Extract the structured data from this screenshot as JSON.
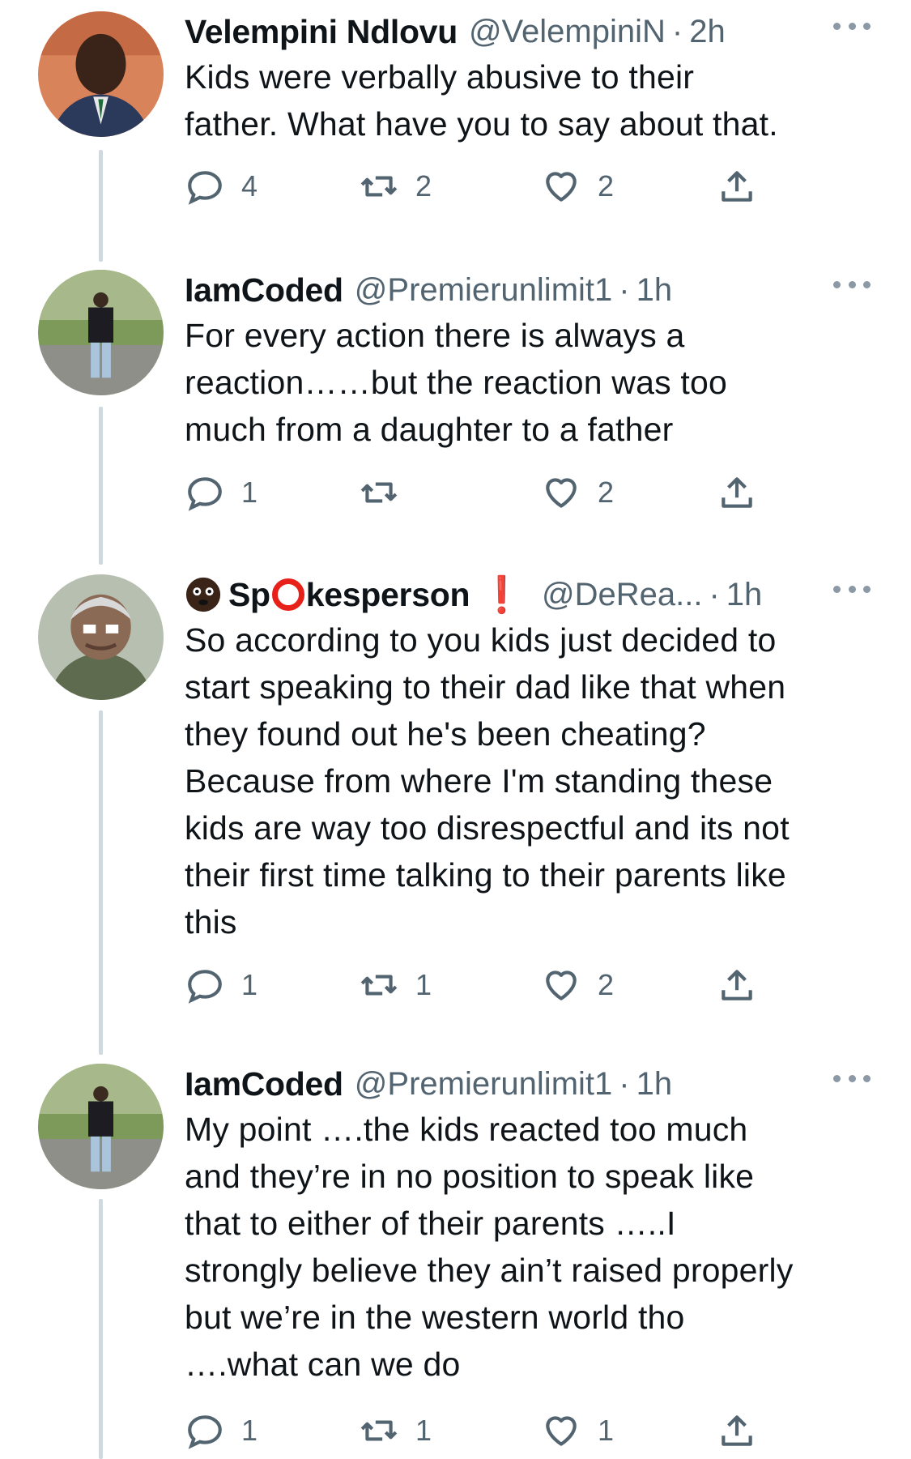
{
  "tweets": [
    {
      "display_name": "Velempini Ndlovu",
      "handle": "@VelempiniN",
      "separator": "·",
      "time": "2h",
      "text": "Kids were verbally abusive to their\nfather. What have you to say about that.",
      "replies": "4",
      "retweets": "2",
      "likes": "2"
    },
    {
      "display_name": "IamCoded",
      "handle": "@Premierunlimit1",
      "separator": "·",
      "time": "1h",
      "text": "For every action there is always a\nreaction……but the reaction was too\nmuch from a daughter to a father",
      "replies": "1",
      "retweets": "",
      "likes": "2"
    },
    {
      "display_name_prefix": "Sp",
      "display_name_suffix": "kesperson",
      "handle": "@DeRea...",
      "separator": "·",
      "time": "1h",
      "text": "So according to you kids just decided to\nstart speaking to their dad like that when\nthey found out he's been cheating?\nBecause from where I'm standing these\nkids are way too disrespectful and its not\ntheir first time talking to their parents like\nthis",
      "replies": "1",
      "retweets": "1",
      "likes": "2"
    },
    {
      "display_name": "IamCoded",
      "handle": "@Premierunlimit1",
      "separator": "·",
      "time": "1h",
      "text": "My point ….the kids reacted too much\nand they’re in no position to speak like\nthat to either of their parents …..I\nstrongly believe they ain’t raised properly\nbut we’re in the western world tho\n….what can we do",
      "replies": "1",
      "retweets": "1",
      "likes": "1"
    }
  ],
  "icons": {
    "reply": "speech-bubble-icon",
    "retweet": "retweet-arrows-icon",
    "like": "heart-outline-icon",
    "share": "share-upload-icon",
    "more": "ellipsis-icon"
  },
  "colors": {
    "text_primary": "#0f1419",
    "text_secondary": "#536471",
    "thread_line": "#cfd9de",
    "red_emoji": "#e8201a"
  }
}
